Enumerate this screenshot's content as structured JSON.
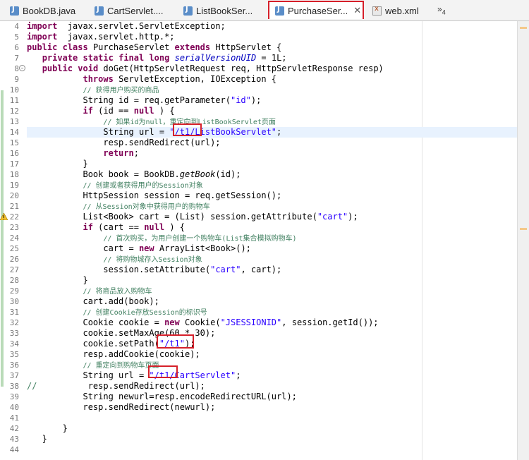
{
  "tabs": [
    {
      "label": "BookDB.java",
      "icon": "java-file-icon",
      "active": false
    },
    {
      "label": "CartServlet....",
      "icon": "java-file-icon",
      "active": false
    },
    {
      "label": "ListBookSer...",
      "icon": "java-file-icon",
      "active": false
    },
    {
      "label": "PurchaseSer...",
      "icon": "java-file-icon",
      "active": true,
      "close": "✕"
    },
    {
      "label": "web.xml",
      "icon": "xml-file-icon",
      "active": false
    }
  ],
  "overflow": {
    "symbol": "»",
    "count": "4"
  },
  "lines": [
    {
      "n": "4",
      "tokens": [
        [
          "kw",
          "import"
        ],
        [
          "",
          "  javax.servlet.ServletException;"
        ]
      ]
    },
    {
      "n": "5",
      "tokens": [
        [
          "kw",
          "import"
        ],
        [
          "",
          "  javax.servlet.http.*;"
        ]
      ]
    },
    {
      "n": "6",
      "tokens": [
        [
          "kw",
          "public"
        ],
        [
          "",
          " "
        ],
        [
          "kw",
          "class"
        ],
        [
          "",
          " PurchaseServlet "
        ],
        [
          "kw",
          "extends"
        ],
        [
          "",
          " HttpServlet {"
        ]
      ]
    },
    {
      "n": "7",
      "tokens": [
        [
          "",
          "   "
        ],
        [
          "kw",
          "private"
        ],
        [
          "",
          " "
        ],
        [
          "kw",
          "static"
        ],
        [
          "",
          " "
        ],
        [
          "kw",
          "final"
        ],
        [
          "",
          " "
        ],
        [
          "kw",
          "long"
        ],
        [
          "",
          " "
        ],
        [
          "fld",
          "serialVersionUID"
        ],
        [
          "",
          " = 1L;"
        ]
      ]
    },
    {
      "n": "8",
      "fold": true,
      "tokens": [
        [
          "",
          "   "
        ],
        [
          "kw",
          "public"
        ],
        [
          "",
          " "
        ],
        [
          "kw",
          "void"
        ],
        [
          "",
          " doGet(HttpServletRequest req, HttpServletResponse resp)"
        ]
      ]
    },
    {
      "n": "9",
      "tokens": [
        [
          "",
          "           "
        ],
        [
          "kw",
          "throws"
        ],
        [
          "",
          " ServletException, IOException {"
        ]
      ]
    },
    {
      "n": "10",
      "tokens": [
        [
          "",
          "           "
        ],
        [
          "cmt",
          "// 获得用户购买的商品"
        ]
      ]
    },
    {
      "n": "11",
      "tokens": [
        [
          "",
          "           String id = req.getParameter("
        ],
        [
          "str",
          "\"id\""
        ],
        [
          "",
          ");"
        ]
      ]
    },
    {
      "n": "12",
      "tokens": [
        [
          "",
          "           "
        ],
        [
          "kw",
          "if"
        ],
        [
          "",
          " (id == "
        ],
        [
          "kw",
          "null"
        ],
        [
          "",
          " ) {"
        ]
      ]
    },
    {
      "n": "13",
      "tokens": [
        [
          "",
          "               "
        ],
        [
          "cmt",
          "// 如果id为null，重定向到ListBookServlet页面"
        ]
      ]
    },
    {
      "n": "14",
      "cur": true,
      "tokens": [
        [
          "",
          "               String url = "
        ],
        [
          "str",
          "\"/t1/ListBookServlet\""
        ],
        [
          "",
          ";"
        ]
      ]
    },
    {
      "n": "15",
      "tokens": [
        [
          "",
          "               resp.sendRedirect(url);"
        ]
      ]
    },
    {
      "n": "16",
      "tokens": [
        [
          "",
          "               "
        ],
        [
          "kw",
          "return"
        ],
        [
          "",
          ";"
        ]
      ]
    },
    {
      "n": "17",
      "tokens": [
        [
          "",
          "           }"
        ]
      ]
    },
    {
      "n": "18",
      "tokens": [
        [
          "",
          "           Book book = BookDB."
        ],
        [
          "meth",
          "getBook"
        ],
        [
          "",
          "(id);"
        ]
      ]
    },
    {
      "n": "19",
      "tokens": [
        [
          "",
          "           "
        ],
        [
          "cmt",
          "// 创建或者获得用户的Session对象"
        ]
      ]
    },
    {
      "n": "20",
      "tokens": [
        [
          "",
          "           HttpSession session = req.getSession();"
        ]
      ]
    },
    {
      "n": "21",
      "tokens": [
        [
          "",
          "           "
        ],
        [
          "cmt",
          "// 从Session对象中获得用户的购物车"
        ]
      ]
    },
    {
      "n": "22",
      "warn": true,
      "tokens": [
        [
          "",
          "           List<Book> cart = (List) session.getAttribute("
        ],
        [
          "str",
          "\"cart\""
        ],
        [
          "",
          ");"
        ]
      ]
    },
    {
      "n": "23",
      "tokens": [
        [
          "",
          "           "
        ],
        [
          "kw",
          "if"
        ],
        [
          "",
          " (cart == "
        ],
        [
          "kw",
          "null"
        ],
        [
          "",
          " ) {"
        ]
      ]
    },
    {
      "n": "24",
      "tokens": [
        [
          "",
          "               "
        ],
        [
          "cmt",
          "// 首次购买，为用户创建一个购物车(List集合模拟购物车)"
        ]
      ]
    },
    {
      "n": "25",
      "tokens": [
        [
          "",
          "               cart = "
        ],
        [
          "kw",
          "new"
        ],
        [
          "",
          " ArrayList<Book>();"
        ]
      ]
    },
    {
      "n": "26",
      "tokens": [
        [
          "",
          "               "
        ],
        [
          "cmt",
          "// 将购物城存入Session对象"
        ]
      ]
    },
    {
      "n": "27",
      "tokens": [
        [
          "",
          "               session.setAttribute("
        ],
        [
          "str",
          "\"cart\""
        ],
        [
          "",
          ", cart);"
        ]
      ]
    },
    {
      "n": "28",
      "tokens": [
        [
          "",
          "           }"
        ]
      ]
    },
    {
      "n": "29",
      "tokens": [
        [
          "",
          "           "
        ],
        [
          "cmt",
          "// 将商品放入购物车"
        ]
      ]
    },
    {
      "n": "30",
      "tokens": [
        [
          "",
          "           cart.add(book);"
        ]
      ]
    },
    {
      "n": "31",
      "tokens": [
        [
          "",
          "           "
        ],
        [
          "cmt",
          "// 创建Cookie存放Session的标识号"
        ]
      ]
    },
    {
      "n": "32",
      "tokens": [
        [
          "",
          "           Cookie cookie = "
        ],
        [
          "kw",
          "new"
        ],
        [
          "",
          " Cookie("
        ],
        [
          "str",
          "\"JSESSIONID\""
        ],
        [
          "",
          ", session.getId());"
        ]
      ]
    },
    {
      "n": "33",
      "tokens": [
        [
          "",
          "           cookie.setMaxAge(60 * 30);"
        ]
      ]
    },
    {
      "n": "34",
      "tokens": [
        [
          "",
          "           cookie.setPath("
        ],
        [
          "str",
          "\"/t1\""
        ],
        [
          "",
          ");"
        ]
      ]
    },
    {
      "n": "35",
      "tokens": [
        [
          "",
          "           resp.addCookie(cookie);"
        ]
      ]
    },
    {
      "n": "36",
      "tokens": [
        [
          "",
          "           "
        ],
        [
          "cmt",
          "// 重定向到购物车页面"
        ]
      ]
    },
    {
      "n": "37",
      "tokens": [
        [
          "",
          "           String url = "
        ],
        [
          "str",
          "\"/t1/CartServlet\""
        ],
        [
          "",
          ";"
        ]
      ]
    },
    {
      "n": "38",
      "tokens": [
        [
          "grn",
          "//"
        ],
        [
          "",
          "          resp.sendRedirect(url);"
        ]
      ]
    },
    {
      "n": "39",
      "tokens": [
        [
          "",
          "           String newurl=resp.encodeRedirectURL(url);"
        ]
      ]
    },
    {
      "n": "40",
      "tokens": [
        [
          "",
          "           resp.sendRedirect(newurl);"
        ]
      ]
    },
    {
      "n": "41",
      "tokens": [
        [
          "",
          ""
        ]
      ]
    },
    {
      "n": "42",
      "tokens": [
        [
          "",
          "       }"
        ]
      ]
    },
    {
      "n": "43",
      "tokens": [
        [
          "",
          "   }"
        ]
      ]
    },
    {
      "n": "44",
      "tokens": [
        [
          "",
          ""
        ]
      ]
    }
  ]
}
